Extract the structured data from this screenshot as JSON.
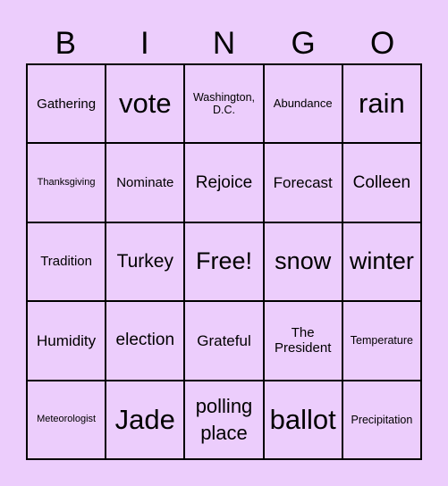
{
  "card": {
    "background_color": "#eccdfc",
    "header": [
      "B",
      "I",
      "N",
      "G",
      "O"
    ],
    "rows": [
      [
        "Gathering",
        "vote",
        "Washington, D.C.",
        "Abundance",
        "rain"
      ],
      [
        "Thanksgiving",
        "Nominate",
        "Rejoice",
        "Forecast",
        "Colleen"
      ],
      [
        "Tradition",
        "Turkey",
        "Free!",
        "snow",
        "winter"
      ],
      [
        "Humidity",
        "election",
        "Grateful",
        "The President",
        "Temperature"
      ],
      [
        "Meteorologist",
        "Jade",
        "polling place",
        "ballot",
        "Precipitation"
      ]
    ]
  }
}
